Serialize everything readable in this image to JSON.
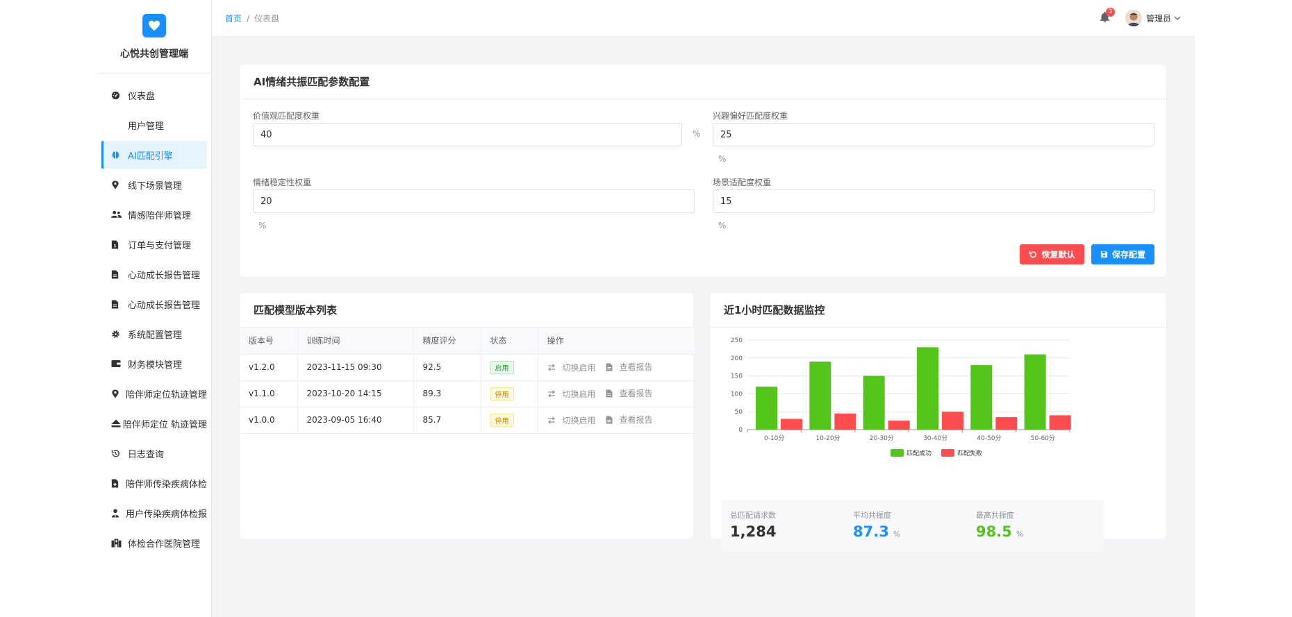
{
  "app": {
    "title": "心悦共创管理端"
  },
  "sidebar": {
    "items": [
      {
        "label": "仪表盘",
        "icon": "dashboard-icon",
        "active": false
      },
      {
        "label": "用户管理",
        "icon": "",
        "active": false
      },
      {
        "label": "AI匹配引擎",
        "icon": "brain-icon",
        "active": true
      },
      {
        "label": "线下场景管理",
        "icon": "map-marker-icon",
        "active": false
      },
      {
        "label": "情感陪伴师管理",
        "icon": "users-icon",
        "active": false
      },
      {
        "label": "订单与支付管理",
        "icon": "invoice-icon",
        "active": false
      },
      {
        "label": "心动成长报告管理",
        "icon": "file-icon",
        "active": false
      },
      {
        "label": "心动成长报告管理",
        "icon": "file-icon",
        "active": false
      },
      {
        "label": "系统配置管理",
        "icon": "gear-icon",
        "active": false
      },
      {
        "label": "财务模块管理",
        "icon": "wallet-icon",
        "active": false
      },
      {
        "label": "陪伴师定位轨迹管理",
        "icon": "map-marker-icon",
        "active": false
      },
      {
        "label": "陪伴师定位 轨迹管理",
        "icon": "eject-icon",
        "active": false
      },
      {
        "label": "日志查询",
        "icon": "history-icon",
        "active": false
      },
      {
        "label": "陪伴师传染疾病体检",
        "icon": "file-medical-icon",
        "active": false
      },
      {
        "label": "用户传染疾病体检报",
        "icon": "user-doctor-icon",
        "active": false
      },
      {
        "label": "体检合作医院管理",
        "icon": "hospital-icon",
        "active": false
      }
    ]
  },
  "header": {
    "breadcrumb_home": "首页",
    "breadcrumb_sep": "/",
    "breadcrumb_current": "仪表盘",
    "notification_count": "3",
    "user_name": "管理员"
  },
  "config": {
    "title": "AI情绪共振匹配参数配置",
    "fields": [
      {
        "label": "价值观匹配度权重",
        "value": "40",
        "unit": "%"
      },
      {
        "label": "兴趣偏好匹配度权重",
        "value": "25",
        "unit": "%"
      },
      {
        "label": "情绪稳定性权重",
        "value": "20",
        "unit": "%"
      },
      {
        "label": "场景适配度权重",
        "value": "15",
        "unit": "%"
      }
    ],
    "reset_label": "恢复默认",
    "save_label": "保存配置"
  },
  "versions": {
    "title": "匹配模型版本列表",
    "columns": [
      "版本号",
      "训练时间",
      "精度评分",
      "状态",
      "操作"
    ],
    "rows": [
      {
        "version": "v1.2.0",
        "time": "2023-11-15 09:30",
        "score": "92.5",
        "status": "启用",
        "status_type": "on"
      },
      {
        "version": "v1.1.0",
        "time": "2023-10-20 14:15",
        "score": "89.3",
        "status": "停用",
        "status_type": "off"
      },
      {
        "version": "v1.0.0",
        "time": "2023-09-05 16:40",
        "score": "85.7",
        "status": "停用",
        "status_type": "off"
      }
    ],
    "action_switch": "切换启用",
    "action_report": "查看报告"
  },
  "monitor": {
    "title": "近1小时匹配数据监控",
    "stats": [
      {
        "label": "总匹配请求数",
        "value": "1,284",
        "unit": "",
        "color": "#303133"
      },
      {
        "label": "平均共振度",
        "value": "87.3",
        "unit": "%",
        "color": "#1890ff"
      },
      {
        "label": "最高共振度",
        "value": "98.5",
        "unit": "%",
        "color": "#52c41a"
      }
    ]
  },
  "chart_data": {
    "type": "bar",
    "categories": [
      "0-10分",
      "10-20分",
      "20-30分",
      "30-40分",
      "40-50分",
      "50-60分"
    ],
    "series": [
      {
        "name": "匹配成功",
        "color": "#52c41a",
        "values": [
          120,
          190,
          150,
          230,
          180,
          210
        ]
      },
      {
        "name": "匹配失败",
        "color": "#ff4d4f",
        "values": [
          30,
          45,
          25,
          50,
          35,
          40
        ]
      }
    ],
    "yticks": [
      0,
      50,
      100,
      150,
      200,
      250
    ],
    "ylim": [
      0,
      250
    ],
    "grid": true,
    "legend": "bottom"
  }
}
